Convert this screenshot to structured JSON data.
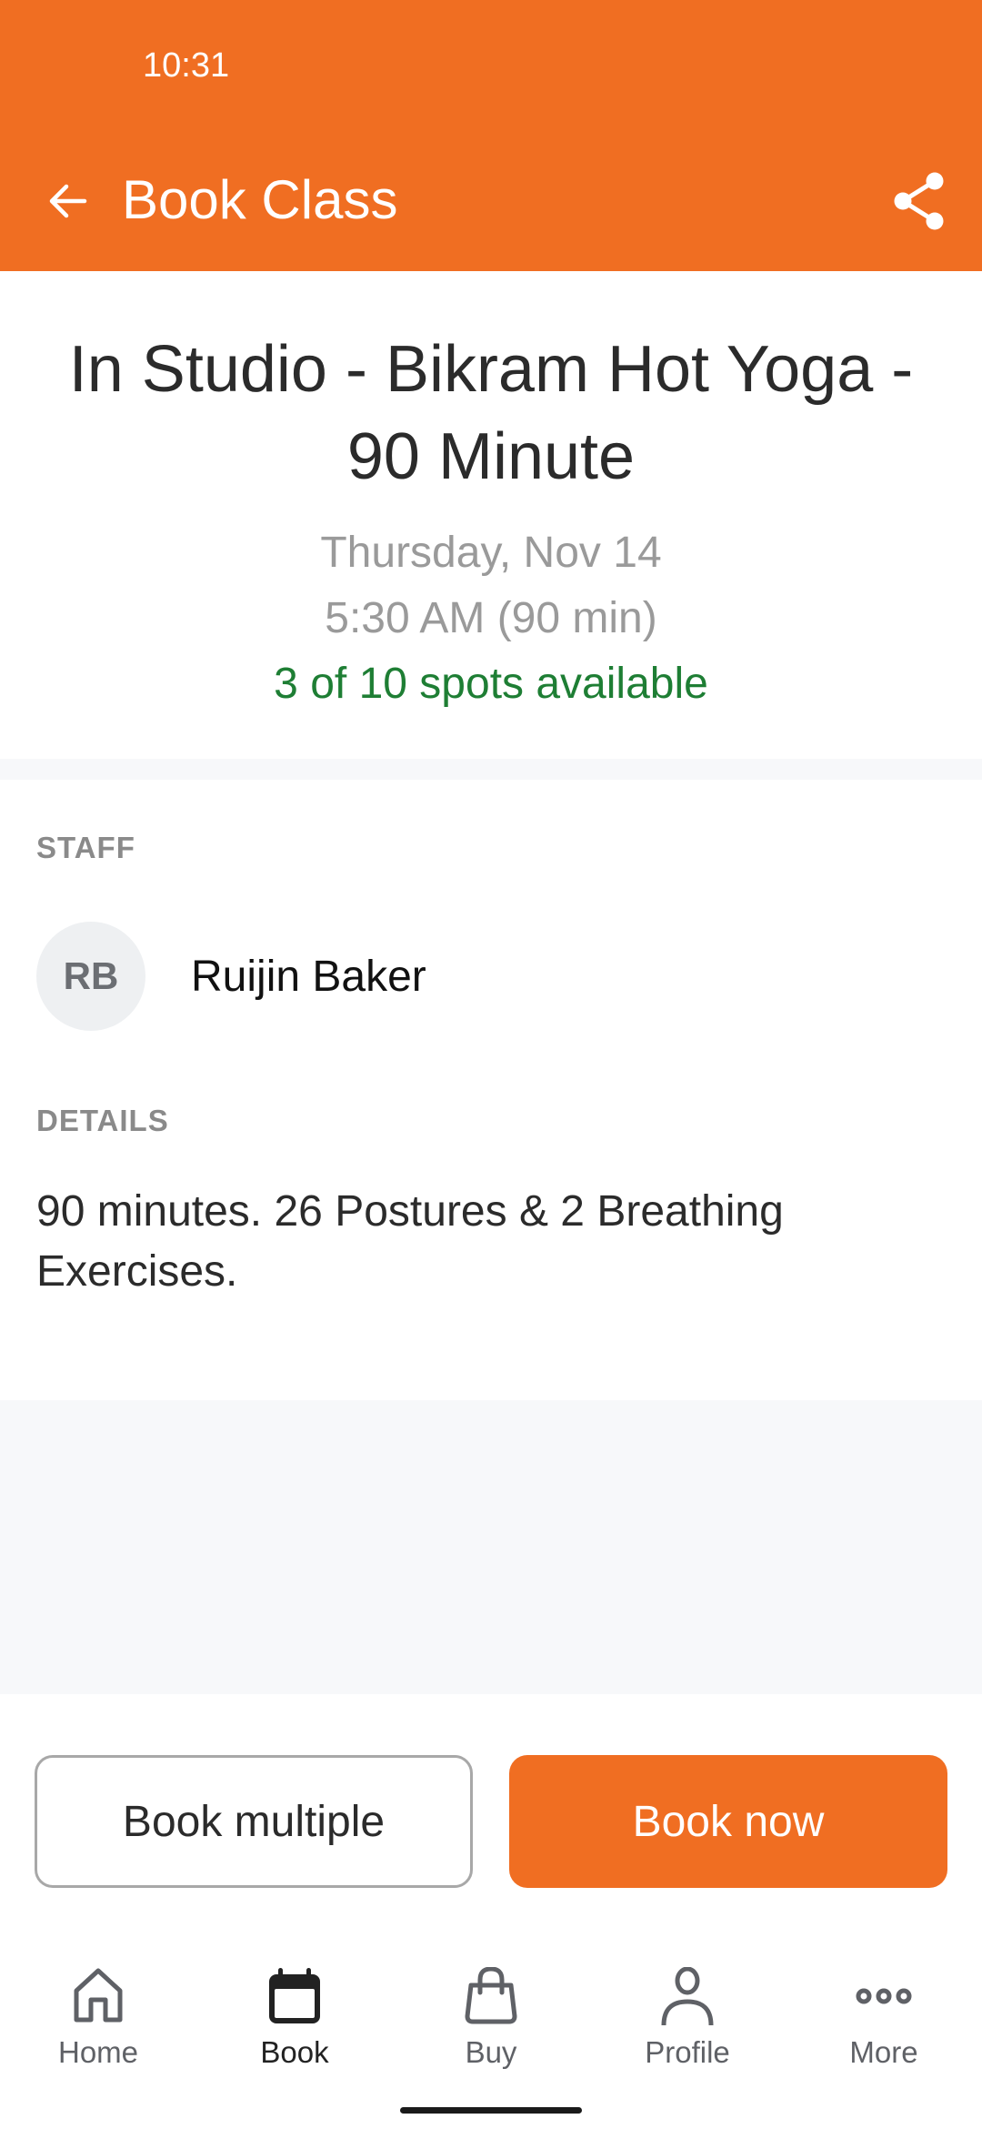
{
  "status_bar": {
    "time": "10:31"
  },
  "header": {
    "title": "Book Class",
    "back_icon": "arrow-left-icon",
    "share_icon": "share-icon"
  },
  "class_info": {
    "title": "In Studio - Bikram Hot Yoga - 90 Minute",
    "date": "Thursday, Nov 14",
    "time": "5:30 AM (90 min)",
    "availability": "3 of 10 spots available",
    "spots_available": 3,
    "spots_total": 10
  },
  "staff": {
    "section_label": "STAFF",
    "initials": "RB",
    "name": "Ruijin Baker"
  },
  "details": {
    "section_label": "DETAILS",
    "text": "90 minutes. 26 Postures & 2 Breathing Exercises."
  },
  "actions": {
    "book_multiple_label": "Book multiple",
    "book_now_label": "Book now"
  },
  "bottom_nav": {
    "items": [
      {
        "label": "Home",
        "icon": "home-icon",
        "active": false
      },
      {
        "label": "Book",
        "icon": "calendar-icon",
        "active": true
      },
      {
        "label": "Buy",
        "icon": "shopping-bag-icon",
        "active": false
      },
      {
        "label": "Profile",
        "icon": "person-icon",
        "active": false
      },
      {
        "label": "More",
        "icon": "more-horizontal-icon",
        "active": false
      }
    ]
  },
  "colors": {
    "brand_orange": "#f06e22",
    "availability_green": "#1e7e34",
    "muted_text": "#9a9a9a",
    "page_background": "#f7f8fa"
  }
}
